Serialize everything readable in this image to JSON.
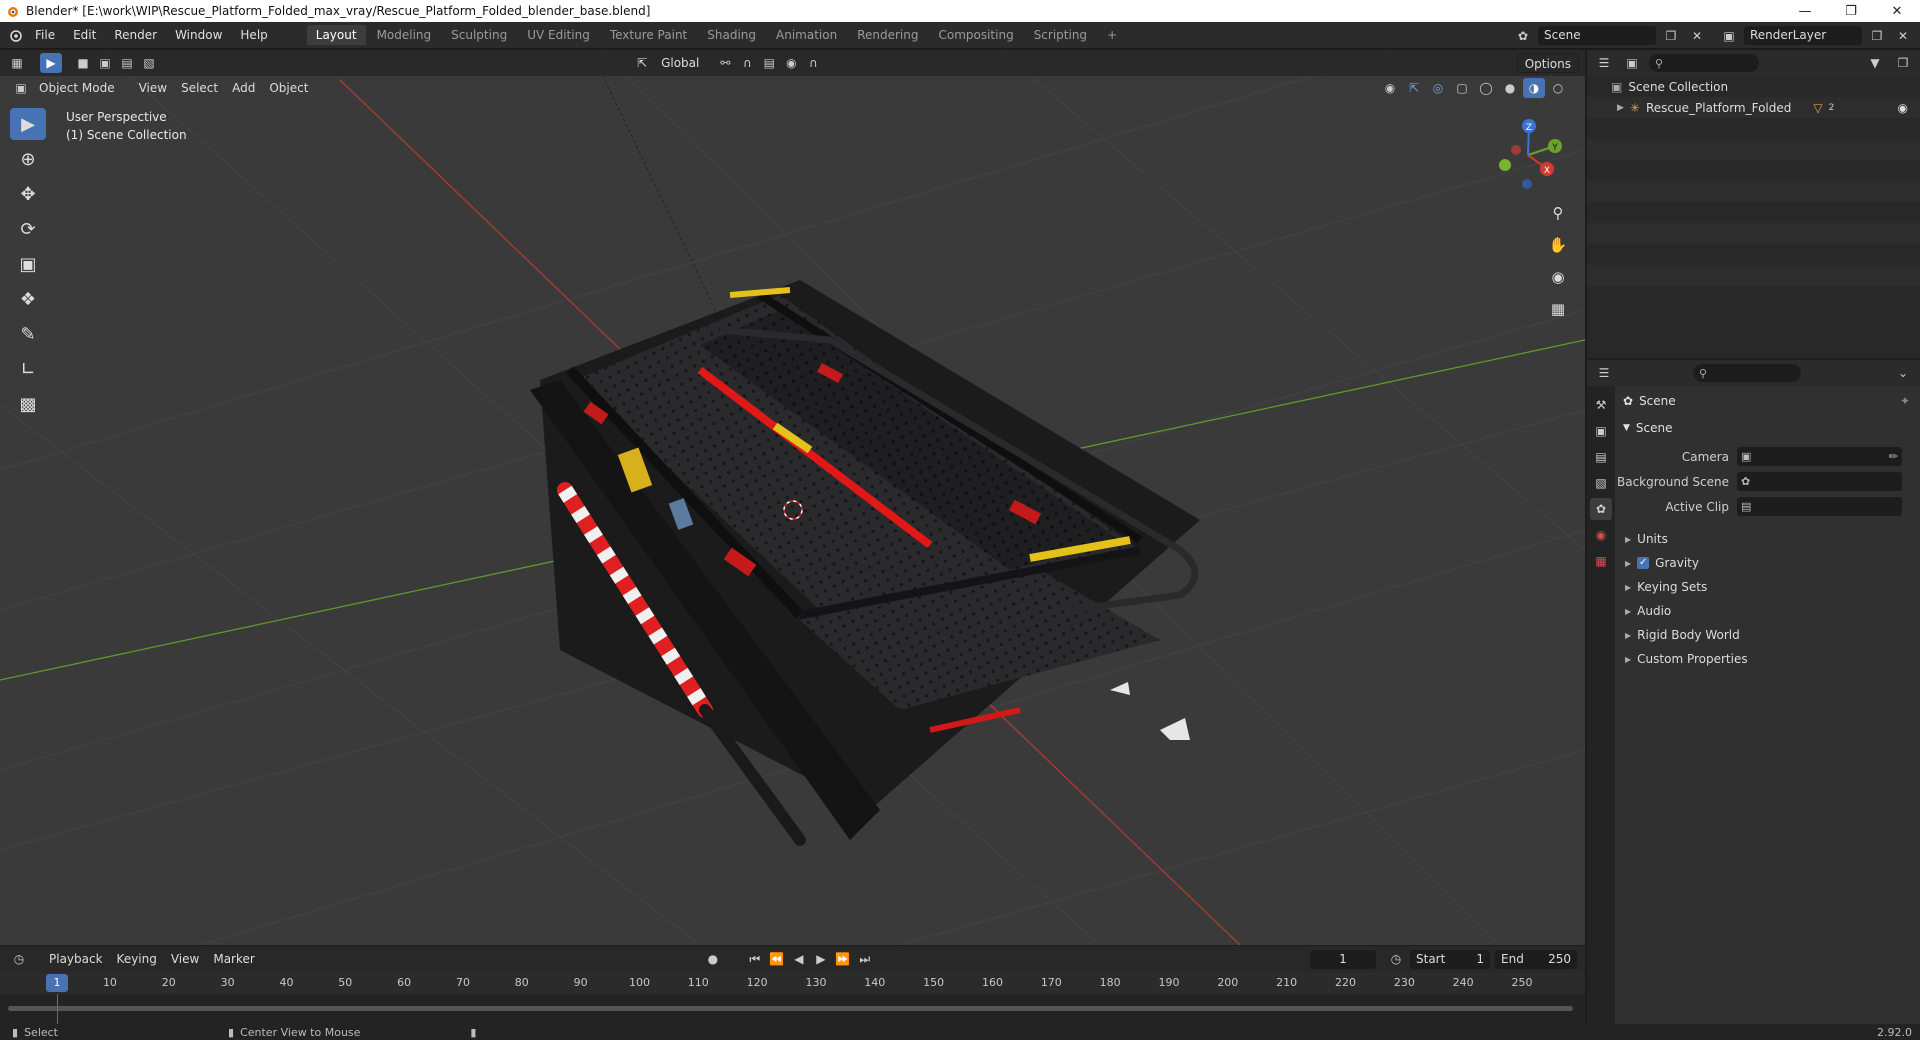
{
  "window": {
    "title": "Blender* [E:\\work\\WIP\\Rescue_Platform_Folded_max_vray/Rescue_Platform_Folded_blender_base.blend]"
  },
  "menu": [
    "File",
    "Edit",
    "Render",
    "Window",
    "Help"
  ],
  "workspaces": [
    "Layout",
    "Modeling",
    "Sculpting",
    "UV Editing",
    "Texture Paint",
    "Shading",
    "Animation",
    "Rendering",
    "Compositing",
    "Scripting"
  ],
  "workspace_add": "+",
  "scene_selector": {
    "value": "Scene"
  },
  "viewlayer_selector": {
    "value": "RenderLayer"
  },
  "viewport": {
    "mode": "Object Mode",
    "menus": [
      "View",
      "Select",
      "Add",
      "Object"
    ],
    "transform_orientation": "Global",
    "options_label": "Options",
    "info_line1": "User Perspective",
    "info_line2": "(1) Scene Collection",
    "gizmo": {
      "x": "X",
      "y": "Y",
      "z": "Z"
    },
    "colors": {
      "bg": "#3a3a3a",
      "grid": "#454545",
      "x_axis": "#c0392b",
      "y_axis": "#6aa329",
      "select": "#4772b3"
    }
  },
  "outliner": {
    "root": "Scene Collection",
    "items": [
      {
        "label": "Rescue_Platform_Folded",
        "badge": "2"
      }
    ]
  },
  "properties": {
    "context_title": "Scene",
    "section": "Scene",
    "rows": [
      {
        "label": "Camera",
        "value": ""
      },
      {
        "label": "Background Scene",
        "value": ""
      },
      {
        "label": "Active Clip",
        "value": ""
      }
    ],
    "subsections": [
      {
        "label": "Units",
        "checkbox": false
      },
      {
        "label": "Gravity",
        "checkbox": true
      },
      {
        "label": "Keying Sets",
        "checkbox": false
      },
      {
        "label": "Audio",
        "checkbox": false
      },
      {
        "label": "Rigid Body World",
        "checkbox": false
      },
      {
        "label": "Custom Properties",
        "checkbox": false
      }
    ]
  },
  "timeline": {
    "menus": [
      "Playback",
      "Keying",
      "View",
      "Marker"
    ],
    "current_frame": "1",
    "start_label": "Start",
    "start_value": "1",
    "end_label": "End",
    "end_value": "250",
    "ticks": [
      "1",
      "10",
      "20",
      "30",
      "40",
      "50",
      "60",
      "70",
      "80",
      "90",
      "100",
      "110",
      "120",
      "130",
      "140",
      "150",
      "160",
      "170",
      "180",
      "190",
      "200",
      "210",
      "220",
      "230",
      "240",
      "250"
    ]
  },
  "statusbar": {
    "select": "Select",
    "center_view": "Center View to Mouse",
    "version": "2.92.0"
  }
}
